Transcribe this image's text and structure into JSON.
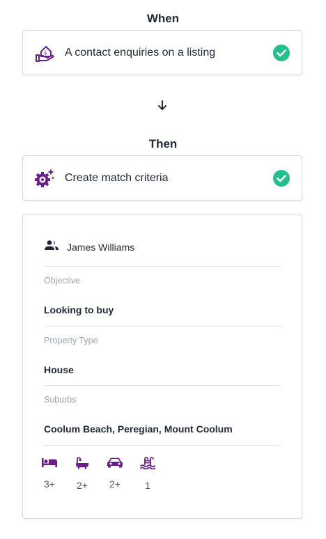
{
  "when": {
    "heading": "When",
    "trigger": {
      "label": "A contact enquiries on a listing",
      "icon": "house-hand-icon",
      "status_icon": "check-circle-icon"
    }
  },
  "flow_arrow": "arrow-down-icon",
  "then": {
    "heading": "Then",
    "action": {
      "label": "Create match criteria",
      "icon": "gear-sparkle-icon",
      "status_icon": "check-circle-icon"
    }
  },
  "details": {
    "contact": {
      "name": "James Williams",
      "icon": "people-icon"
    },
    "fields": [
      {
        "label": "Objective",
        "value": "Looking to buy"
      },
      {
        "label": "Property Type",
        "value": "House"
      },
      {
        "label": "Suburbs",
        "value": "Coolum Beach, Peregian, Mount Coolum"
      }
    ],
    "features": [
      {
        "icon": "bed-icon",
        "value": "3+"
      },
      {
        "icon": "bath-icon",
        "value": "2+"
      },
      {
        "icon": "car-icon",
        "value": "2+"
      },
      {
        "icon": "pool-icon",
        "value": "1"
      }
    ]
  },
  "colors": {
    "accent": "#6b1f8a",
    "success": "#22c08a",
    "text": "#1f2937",
    "muted": "#9ca3af",
    "border": "#d9d9dd"
  }
}
